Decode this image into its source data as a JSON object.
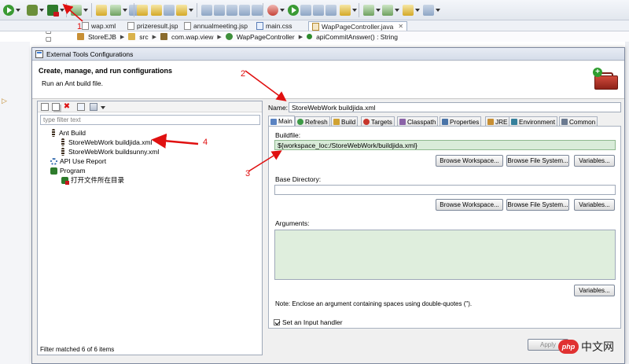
{
  "ide": {
    "editor_tabs": [
      {
        "label": "wap.xml"
      },
      {
        "label": "prizeresult.jsp"
      },
      {
        "label": "annualmeeting.jsp"
      },
      {
        "label": "main.css"
      },
      {
        "label": "WapPageController.java",
        "close": "✕"
      }
    ],
    "breadcrumb": [
      "StoreEJB",
      "src",
      "com.wap.view",
      "WapPageController",
      "apiCommitAnswer() : String"
    ]
  },
  "dialog": {
    "title": "External Tools Configurations",
    "header_title": "Create, manage, and run configurations",
    "header_subtitle": "Run an Ant build file.",
    "filter_placeholder": "type filter text",
    "tree": [
      {
        "label": "Ant Build",
        "icon": "ant-icon",
        "level": 0
      },
      {
        "label": "StoreWebWork buildjida.xml",
        "icon": "ant-icon",
        "level": 1
      },
      {
        "label": "StoreWebWork buildsunny.xml",
        "icon": "ant-icon",
        "level": 1
      },
      {
        "label": "API Use Report",
        "icon": "gear-icon",
        "level": 0
      },
      {
        "label": "Program",
        "icon": "program-icon",
        "level": 0
      },
      {
        "label": "打开文件所在目录",
        "icon": "program-icon",
        "level": 1
      }
    ],
    "filter_status": "Filter matched 6 of 6 items",
    "name_label": "Name:",
    "name_value": "StoreWebWork buildjida.xml",
    "tabs": [
      {
        "label": "Main",
        "icon": "main"
      },
      {
        "label": "Refresh",
        "icon": "refresh"
      },
      {
        "label": "Build",
        "icon": "build"
      },
      {
        "label": "Targets",
        "icon": "targets"
      },
      {
        "label": "Classpath",
        "icon": "classpath"
      },
      {
        "label": "Properties",
        "icon": "props"
      },
      {
        "label": "JRE",
        "icon": "jre"
      },
      {
        "label": "Environment",
        "icon": "env"
      },
      {
        "label": "Common",
        "icon": "common"
      }
    ],
    "buildfile_label": "Buildfile:",
    "buildfile_value": "${workspace_loc:/StoreWebWork/buildjida.xml}",
    "base_dir_label": "Base Directory:",
    "base_dir_value": "",
    "arguments_label": "Arguments:",
    "browse_workspace": "Browse Workspace...",
    "browse_file_system": "Browse File System...",
    "variables": "Variables...",
    "note": "Note: Enclose an argument containing spaces using double-quotes (\").",
    "input_handler_label": "Set an Input handler",
    "input_handler_checked": true,
    "apply_label": "Apply"
  },
  "watermark": {
    "logo": "php",
    "text": "中文网"
  },
  "annotations": [
    "1",
    "2",
    "3",
    "4"
  ],
  "colors": {
    "annotation": "#e01010",
    "selected_field": "#d9ecd9"
  }
}
